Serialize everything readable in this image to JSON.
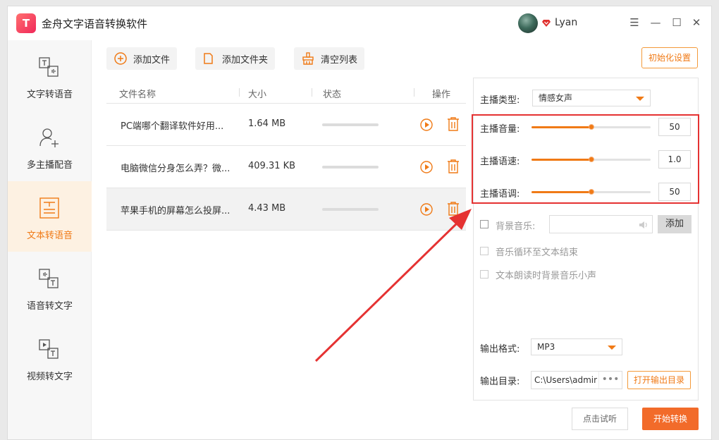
{
  "app": {
    "title": "金舟文字语音转换软件",
    "logo_text": "T",
    "username": "Lyan"
  },
  "window_controls": {
    "menu": "☰",
    "minimize": "—",
    "maximize": "☐",
    "close": "✕"
  },
  "sidebar": {
    "items": [
      {
        "label": "文字转语音",
        "icon": "text-to-speech-icon",
        "active": false
      },
      {
        "label": "多主播配音",
        "icon": "multi-speaker-icon",
        "active": false
      },
      {
        "label": "文本转语音",
        "icon": "document-to-speech-icon",
        "active": true
      },
      {
        "label": "语音转文字",
        "icon": "speech-to-text-icon",
        "active": false
      },
      {
        "label": "视频转文字",
        "icon": "video-to-text-icon",
        "active": false
      }
    ]
  },
  "toolbar": {
    "add_file": "添加文件",
    "add_folder": "添加文件夹",
    "clear_list": "清空列表",
    "reset": "初始化设置"
  },
  "table": {
    "headers": {
      "name": "文件名称",
      "size": "大小",
      "status": "状态",
      "actions": "操作"
    },
    "rows": [
      {
        "name": "PC端哪个翻译软件好用...",
        "size": "1.64 MB",
        "progress": 0
      },
      {
        "name": "电脑微信分身怎么弄？微...",
        "size": "409.31 KB",
        "progress": 0
      },
      {
        "name": "苹果手机的屏幕怎么投屏...",
        "size": "4.43 MB",
        "progress": 0
      }
    ]
  },
  "settings": {
    "anchor_type_label": "主播类型:",
    "anchor_type_value": "情感女声",
    "volume": {
      "label": "主播音量:",
      "value": "50",
      "fraction": 0.5
    },
    "speed": {
      "label": "主播语速:",
      "value": "1.0",
      "fraction": 0.5
    },
    "pitch": {
      "label": "主播语调:",
      "value": "50",
      "fraction": 0.5
    },
    "bgm_label": "背景音乐:",
    "bgm_add": "添加",
    "loop_label": "音乐循环至文本结束",
    "duck_label": "文本朗读时背景音乐小声",
    "output_format_label": "输出格式:",
    "output_format_value": "MP3",
    "output_dir_label": "输出目录:",
    "output_dir_value": "C:\\Users\\admir",
    "browse": "•••",
    "open_dir": "打开输出目录"
  },
  "footer": {
    "trial": "点击试听",
    "start": "开始转换"
  },
  "colors": {
    "accent": "#f07a16",
    "annotation": "#e53232",
    "start_button": "#f26b2a"
  }
}
